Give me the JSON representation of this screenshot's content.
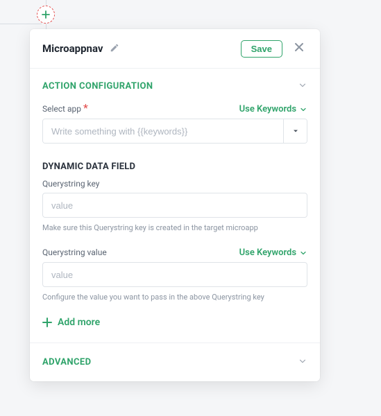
{
  "header": {
    "title": "Microappnav",
    "save_label": "Save"
  },
  "sections": {
    "action_config": {
      "title": "ACTION CONFIGURATION",
      "select_app_label": "Select app",
      "use_keywords": "Use Keywords",
      "select_app_placeholder": "Write something with {{keywords}}",
      "dynamic_heading": "DYNAMIC DATA FIELD",
      "qs_key_label": "Querystring key",
      "qs_key_placeholder": "value",
      "qs_key_helper": "Make sure this Querystring key is created in the target microapp",
      "qs_value_label": "Querystring value",
      "qs_value_placeholder": "value",
      "qs_value_helper": "Configure the value you want to pass in the above Querystring key",
      "add_more": "Add more"
    },
    "advanced": {
      "title": "ADVANCED"
    }
  }
}
